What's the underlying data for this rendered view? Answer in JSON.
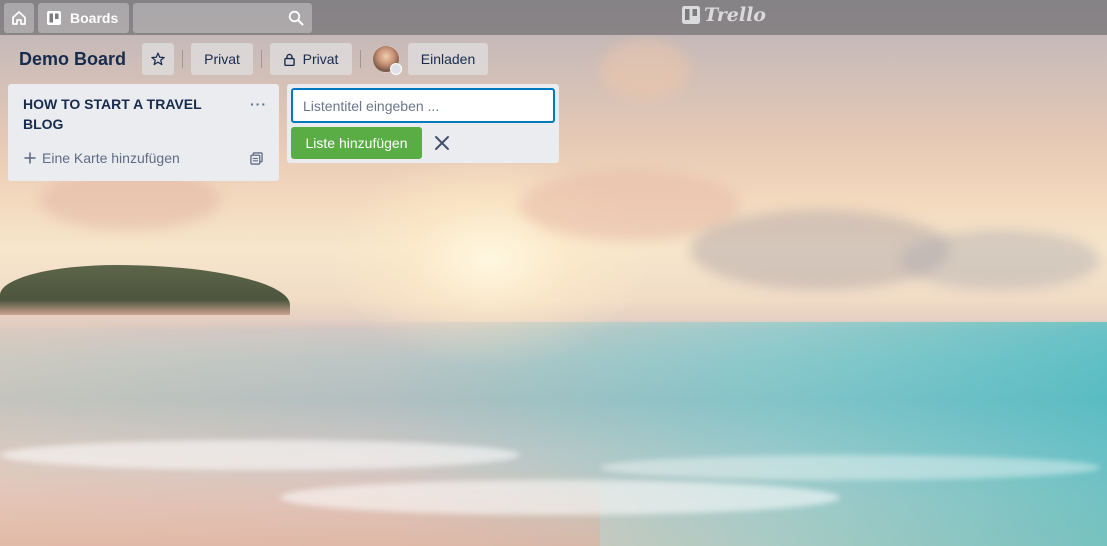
{
  "header": {
    "boards_label": "Boards",
    "logo_text": "Trello",
    "icons": {
      "home": "home-icon",
      "boards": "boards-icon",
      "search": "search-icon"
    }
  },
  "board": {
    "title": "Demo Board",
    "visibility_label": "Privat",
    "team_label": "Privat",
    "invite_label": "Einladen"
  },
  "lists": [
    {
      "title": "HOW TO START A TRAVEL BLOG",
      "menu_glyph": "···",
      "add_card_label": "Eine Karte hinzufügen"
    }
  ],
  "add_list": {
    "placeholder": "Listentitel eingeben ...",
    "value": "",
    "submit_label": "Liste hinzufügen"
  },
  "colors": {
    "submit_green": "#5aac44",
    "input_border": "#0079bf",
    "list_bg": "#ebecf0",
    "text_dark": "#172b4d"
  }
}
